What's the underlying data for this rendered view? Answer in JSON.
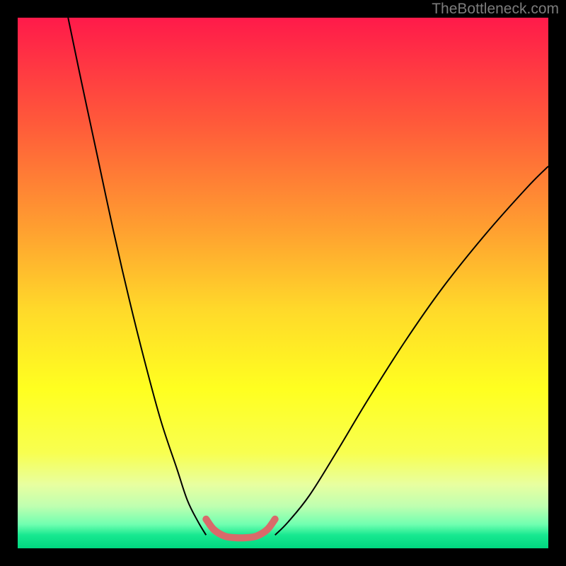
{
  "watermark": {
    "text": "TheBottleneck.com"
  },
  "chart_data": {
    "type": "line",
    "title": "",
    "xlabel": "",
    "ylabel": "",
    "xlim": [
      0,
      100
    ],
    "ylim": [
      0,
      100
    ],
    "grid": false,
    "legend": false,
    "gradient_stops": [
      {
        "offset": 0,
        "color": "#ff1a4a"
      },
      {
        "offset": 0.2,
        "color": "#ff5a3a"
      },
      {
        "offset": 0.4,
        "color": "#ffa030"
      },
      {
        "offset": 0.55,
        "color": "#ffd92a"
      },
      {
        "offset": 0.7,
        "color": "#ffff20"
      },
      {
        "offset": 0.82,
        "color": "#f8ff50"
      },
      {
        "offset": 0.88,
        "color": "#e8ffa0"
      },
      {
        "offset": 0.92,
        "color": "#c0ffb0"
      },
      {
        "offset": 0.955,
        "color": "#70ffb0"
      },
      {
        "offset": 0.975,
        "color": "#18e890"
      },
      {
        "offset": 1.0,
        "color": "#00d880"
      }
    ],
    "series": [
      {
        "name": "left-descent",
        "stroke": "#000000",
        "stroke_width": 2,
        "x": [
          9.5,
          12,
          15,
          18,
          21,
          24,
          27,
          30,
          32,
          34,
          35.5
        ],
        "y": [
          100,
          88,
          74,
          60,
          47,
          35,
          24,
          15,
          9,
          5,
          2.5
        ]
      },
      {
        "name": "trough-thick",
        "stroke": "#d96a6a",
        "stroke_width": 10,
        "stroke_linecap": "round",
        "x": [
          35.5,
          37,
          39,
          41,
          43,
          45,
          47,
          48.5
        ],
        "y": [
          5.5,
          3.5,
          2.3,
          2.0,
          2.0,
          2.3,
          3.5,
          5.5
        ]
      },
      {
        "name": "right-ascent",
        "stroke": "#000000",
        "stroke_width": 2,
        "x": [
          48.5,
          51,
          55,
          60,
          66,
          73,
          80,
          88,
          96,
          100
        ],
        "y": [
          2.5,
          5,
          10,
          18,
          28,
          39,
          49,
          59,
          68,
          72
        ]
      }
    ]
  }
}
